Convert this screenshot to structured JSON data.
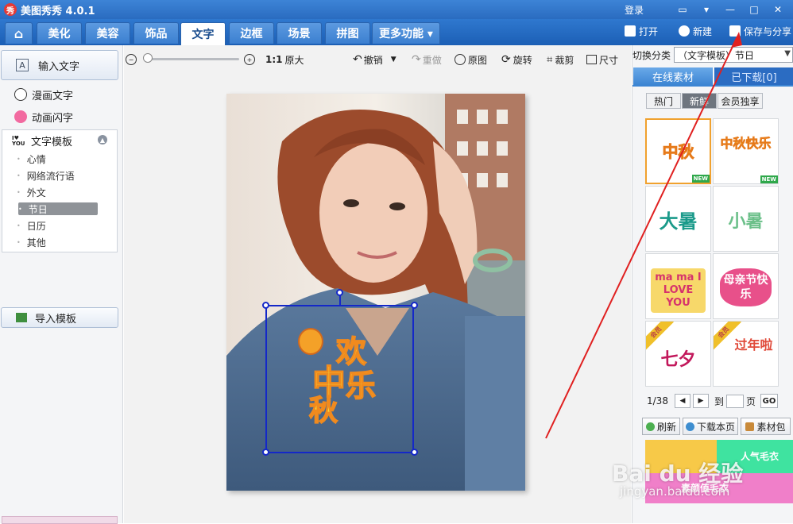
{
  "app": {
    "title": "美图秀秀 4.0.1",
    "logo_text": "秀",
    "login_label": "登录"
  },
  "tabs": [
    {
      "label": "⌂"
    },
    {
      "label": "美化"
    },
    {
      "label": "美容"
    },
    {
      "label": "饰品"
    },
    {
      "label": "文字"
    },
    {
      "label": "边框"
    },
    {
      "label": "场景"
    },
    {
      "label": "拼图"
    },
    {
      "label": "更多功能 ▾"
    }
  ],
  "file_actions": {
    "open_label": "打开",
    "new_label": "新建",
    "save_label": "保存与分享"
  },
  "sidebar": {
    "input_text_label": "输入文字",
    "comic_text_label": "漫画文字",
    "flash_text_label": "动画闪字",
    "template_header": "文字模板",
    "template_items": [
      "心情",
      "网络流行语",
      "外文",
      "节日",
      "日历",
      "其他"
    ],
    "selected_template": "节日",
    "import_label": "导入模板"
  },
  "center_toolbar": {
    "ratio_label": "1:1",
    "original_size_label": "原大",
    "undo_label": "撤销",
    "redo_label": "重做",
    "original_label": "原图",
    "rotate_label": "旋转",
    "crop_label": "裁剪",
    "size_label": "尺寸"
  },
  "sticker": {
    "line1": "欢",
    "line2": "中",
    "line3": "乐",
    "line4": "秋"
  },
  "right_panel": {
    "category_label": "切换分类",
    "category_value": "（文字模板）节日",
    "tab_online": "在线素材",
    "tab_downloaded": "已下载[0]",
    "seg_hot": "热门",
    "seg_new": "新鲜",
    "seg_vip": "会员独享",
    "thumbnails": [
      {
        "text": "中秋",
        "badge": "NEW"
      },
      {
        "text": "中秋快乐",
        "badge": "NEW"
      },
      {
        "text": "大暑"
      },
      {
        "text": "小暑"
      },
      {
        "text": "ma ma I LOVE YOU"
      },
      {
        "text": "母亲节快乐"
      },
      {
        "text": "七夕",
        "ribbon": "会员"
      },
      {
        "text": "过年啦",
        "ribbon": "会员"
      }
    ],
    "page_info": "1/38",
    "goto_label": "到",
    "page_label": "页",
    "go_label": "GO",
    "refresh_label": "刷新",
    "download_page_label": "下载本页",
    "material_pack_label": "素材包",
    "ad_texts": [
      "人气毛衣",
      "素颜值毛衣"
    ]
  },
  "watermark": {
    "main": "Bai du 经验",
    "sub": "jingyan.baidu.com"
  }
}
